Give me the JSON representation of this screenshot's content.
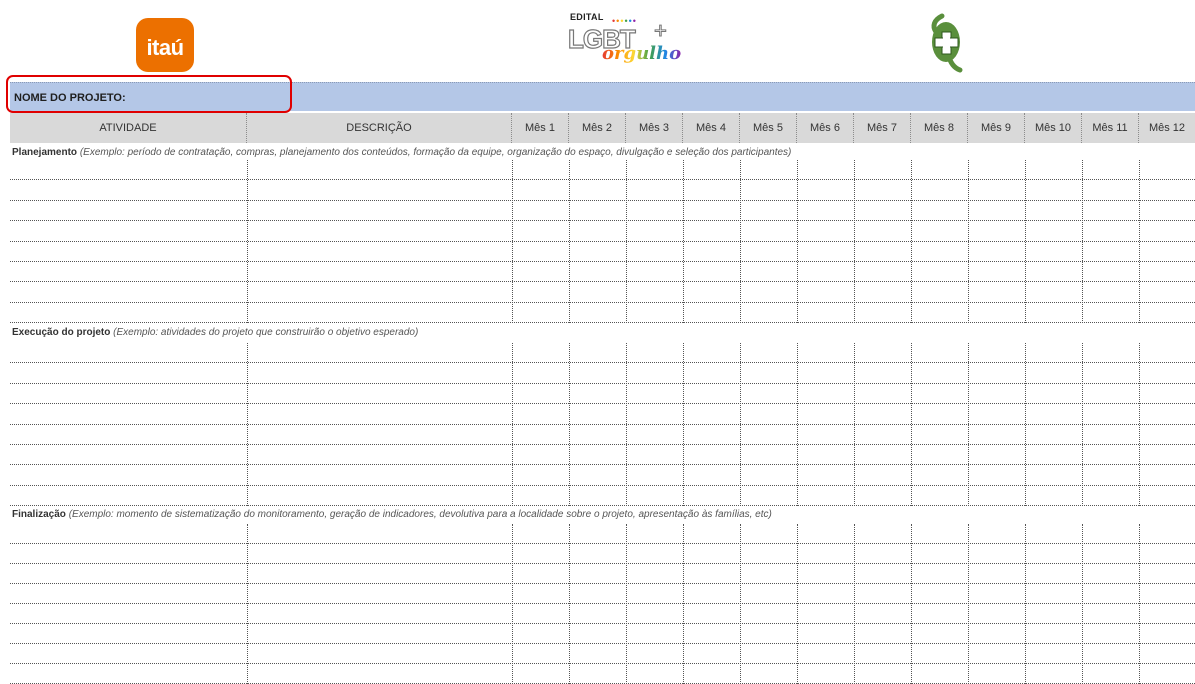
{
  "logos": {
    "itau": "itaú",
    "edital_word": "EDITAL",
    "edital_lgbt": "LGBT",
    "edital_plus": "+",
    "edital_orgulho": "orgulho",
    "emblem": "health-cross-emblem"
  },
  "project": {
    "label": "NOME DO PROJETO:"
  },
  "table": {
    "headers": [
      "ATIVIDADE",
      "DESCRIÇÃO",
      "Mês 1",
      "Mês 2",
      "Mês 3",
      "Mês 4",
      "Mês 5",
      "Mês 6",
      "Mês 7",
      "Mês 8",
      "Mês 9",
      "Mês 10",
      "Mês 11",
      "Mês 12"
    ]
  },
  "sections": [
    {
      "title": "Planejamento",
      "example": "(Exemplo: período de contratação, compras, planejamento dos conteúdos, formação da equipe, organização do espaço, divulgação e seleção dos participantes)"
    },
    {
      "title": "Execução do projeto",
      "example": "(Exemplo: atividades do projeto que construirão o objetivo esperado)"
    },
    {
      "title": "Finalização",
      "example": "(Exemplo: momento de sistematização do monitoramento, geração de indicadores, devolutiva para a localidade sobre o projeto, apresentação às famílias, etc)"
    }
  ],
  "colors": {
    "itau_orange": "#ec7000",
    "project_bar": "#b4c7e7",
    "header_bg": "#d9d9d9",
    "highlight_red": "#e00000",
    "emblem_green": "#5a8f3c"
  }
}
